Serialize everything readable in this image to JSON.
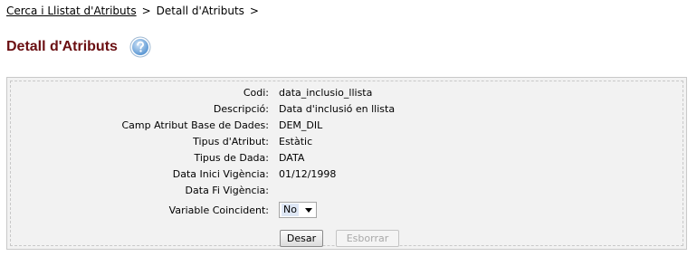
{
  "breadcrumb": {
    "items": [
      "Cerca i Llistat d'Atributs",
      "Detall d'Atributs"
    ],
    "separator": ">"
  },
  "page": {
    "title": "Detall d'Atributs",
    "help_icon": "question-mark-icon"
  },
  "form": {
    "fields": [
      {
        "label": "Codi:",
        "value": "data_inclusio_llista"
      },
      {
        "label": "Descripció:",
        "value": "Data d'inclusió en llista"
      },
      {
        "label": "Camp Atribut Base de Dades:",
        "value": "DEM_DIL"
      },
      {
        "label": "Tipus d'Atribut:",
        "value": "Estàtic"
      },
      {
        "label": "Tipus de Dada:",
        "value": "DATA"
      },
      {
        "label": "Data Inici Vigència:",
        "value": "01/12/1998"
      },
      {
        "label": "Data Fi Vigència:",
        "value": ""
      }
    ],
    "coincident": {
      "label": "Variable Coincident:",
      "selected": "No"
    }
  },
  "buttons": {
    "save": "Desar",
    "delete": "Esborrar"
  },
  "colors": {
    "title": "#6b0f12",
    "panel_bg": "#f2f2f2",
    "help_icon": "#6aa3d8"
  }
}
